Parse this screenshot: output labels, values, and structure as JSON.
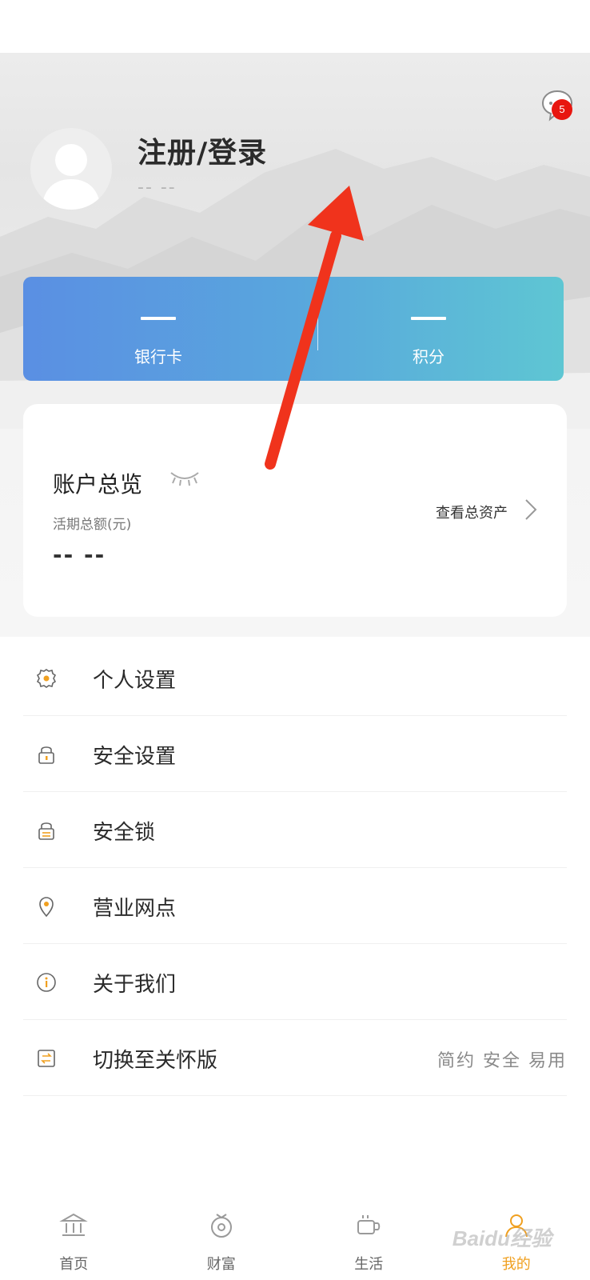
{
  "header": {
    "login_title": "注册/登录",
    "login_subtitle": "-- --",
    "message_badge_count": "5"
  },
  "summary_card": {
    "bank_card_value": "—",
    "bank_card_label": "银行卡",
    "points_value": "—",
    "points_label": "积分"
  },
  "account": {
    "title": "账户总览",
    "subtitle": "活期总额(元)",
    "value": "-- --",
    "view_assets_label": "查看总资产"
  },
  "menu": {
    "items": [
      {
        "label": "个人设置",
        "icon": "gear-icon",
        "right_text": ""
      },
      {
        "label": "安全设置",
        "icon": "lock-icon",
        "right_text": ""
      },
      {
        "label": "安全锁",
        "icon": "lock-icon",
        "right_text": ""
      },
      {
        "label": "营业网点",
        "icon": "location-pin-icon",
        "right_text": ""
      },
      {
        "label": "关于我们",
        "icon": "info-icon",
        "right_text": ""
      },
      {
        "label": "切换至关怀版",
        "icon": "switch-icon",
        "right_text": "简约 安全 易用"
      }
    ]
  },
  "tabbar": {
    "tabs": [
      {
        "label": "首页",
        "icon": "bank-icon"
      },
      {
        "label": "财富",
        "icon": "wealth-icon"
      },
      {
        "label": "生活",
        "icon": "coffee-icon"
      },
      {
        "label": "我的",
        "icon": "user-icon"
      }
    ],
    "active_color": "#f0a020"
  },
  "watermark_text": "Baidu经验",
  "colors": {
    "card_gradient_start": "#5a8fe3",
    "card_gradient_end": "#5ec6d3",
    "badge": "#e8160f",
    "annotation_arrow": "#f0331c"
  }
}
